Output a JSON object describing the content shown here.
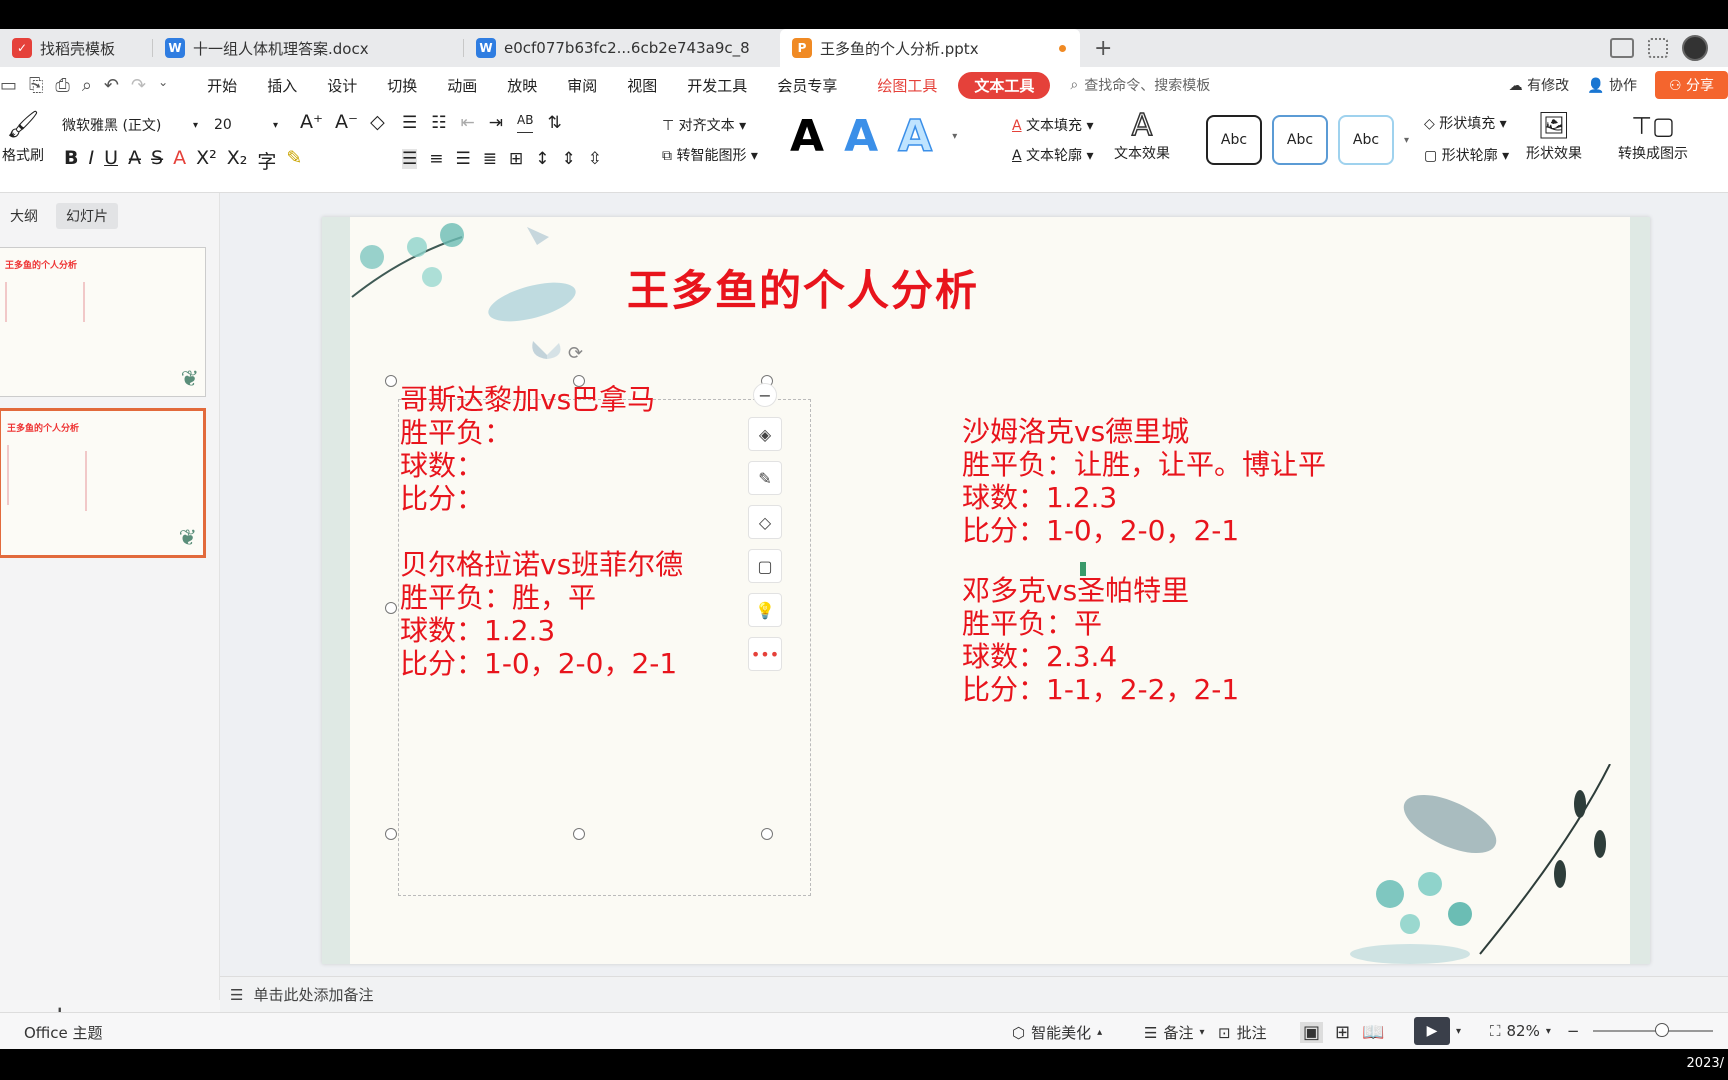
{
  "tabs": [
    {
      "label": "找稻壳模板",
      "icon_color": "#e5413a"
    },
    {
      "label": "十一组人体机理答案.docx",
      "icon_color": "#2f7de1"
    },
    {
      "label": "e0cf077b63fc2...6cb2e743a9c_8",
      "icon_color": "#2f7de1"
    },
    {
      "label": "王多鱼的个人分析.pptx",
      "icon_color": "#f08a24"
    }
  ],
  "menu": [
    "开始",
    "插入",
    "设计",
    "切换",
    "动画",
    "放映",
    "审阅",
    "视图",
    "开发工具",
    "会员专享",
    "绘图工具",
    "文本工具"
  ],
  "search_placeholder": "查找命令、搜索模板",
  "top_right": {
    "modify": "有修改",
    "collab": "协作",
    "share": "分享"
  },
  "ribbon": {
    "format_painter": "格式刷",
    "font_name": "微软雅黑 (正文)",
    "font_size": "20",
    "align_text": "对齐文本",
    "smart_shape": "转智能图形",
    "text_fill": "文本填充",
    "text_outline": "文本轮廓",
    "text_effect": "文本效果",
    "abc": "Abc",
    "shape_fill": "形状填充",
    "shape_outline": "形状轮廓",
    "shape_effect": "形状效果",
    "convert_diagram": "转换成图示",
    "text_style_letter": "A",
    "ab_label": "AB"
  },
  "left_panel": {
    "tab_outline": "大纲",
    "tab_slides": "幻灯片"
  },
  "slide": {
    "title": "王多鱼的个人分析",
    "left_box": {
      "match1": "哥斯达黎加vs巴拿马",
      "m1_wdl": "胜平负：",
      "m1_goals": "球数：",
      "m1_score": "比分：",
      "match2": "贝尔格拉诺vs班菲尔德",
      "m2_wdl": "胜平负：胜，平",
      "m2_goals": "球数：1.2.3",
      "m2_score": "比分：1-0，2-0，2-1"
    },
    "right_box": {
      "match3": "沙姆洛克vs德里城",
      "m3_wdl": "胜平负：让胜，让平。博让平",
      "m3_goals": "球数：1.2.3",
      "m3_score": "比分：1-0，2-0，2-1",
      "match4": "邓多克vs圣帕特里",
      "m4_wdl": "胜平负：平",
      "m4_goals": "球数：2.3.4",
      "m4_score": "比分：1-1，2-2，2-1"
    }
  },
  "notes_placeholder": "单击此处添加备注",
  "status": {
    "theme": "Office 主题",
    "beautify": "智能美化",
    "notes": "备注",
    "comment": "批注",
    "zoom": "82%",
    "clock": "2023/"
  },
  "colors": {
    "accent": "#e5413a",
    "slide_text": "#e8141c"
  }
}
